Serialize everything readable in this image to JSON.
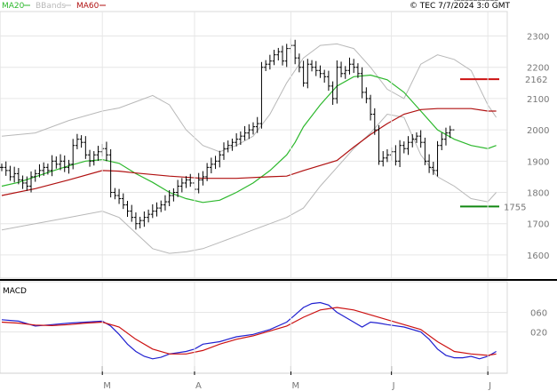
{
  "header": {
    "legend": [
      {
        "label": "MA20",
        "color": "#2db82d"
      },
      {
        "label": "BBands",
        "color": "#b8b8b8"
      },
      {
        "label": "MA60",
        "color": "#b01010"
      }
    ],
    "copyright": "© TEC 7/7/2024 3:0 GMT"
  },
  "colors": {
    "price_bar": "#000000",
    "ma20": "#2db82d",
    "ma60": "#b01010",
    "bbands": "#b8b8b8",
    "grid": "#e6e6e6",
    "resistance": "#cc1111",
    "support": "#118811",
    "macd": "#2020d0",
    "signal": "#cc1111"
  },
  "chart_data": [
    {
      "type": "line",
      "panel": "price",
      "ylim": [
        1540,
        2330
      ],
      "yticks": [
        1600,
        1700,
        1800,
        1900,
        2000,
        2100,
        2200,
        2300
      ],
      "ytick_labels": [
        "1600",
        "1700",
        "1800",
        "1900",
        "2000",
        "2100",
        "2200",
        "2300"
      ],
      "xlim": [
        0,
        120
      ],
      "xticks": [
        24,
        46,
        69,
        93,
        116
      ],
      "xtick_labels": [
        "M",
        "A",
        "M",
        "J",
        "J"
      ],
      "levels": [
        {
          "name": "resistance",
          "value": 2162,
          "label": "2162"
        },
        {
          "name": "support",
          "value": 1755,
          "label": "1755"
        }
      ],
      "series": [
        {
          "name": "MA20",
          "x": [
            0,
            4,
            8,
            12,
            16,
            20,
            24,
            28,
            32,
            36,
            40,
            44,
            48,
            52,
            56,
            60,
            64,
            68,
            70,
            72,
            76,
            80,
            84,
            88,
            92,
            96,
            100,
            104,
            108,
            112,
            116,
            118
          ],
          "values": [
            1820,
            1832,
            1850,
            1868,
            1885,
            1900,
            1905,
            1893,
            1860,
            1832,
            1800,
            1780,
            1768,
            1775,
            1800,
            1830,
            1870,
            1920,
            1960,
            2010,
            2080,
            2140,
            2170,
            2175,
            2160,
            2120,
            2060,
            2000,
            1970,
            1950,
            1940,
            1950
          ]
        },
        {
          "name": "MA60",
          "x": [
            0,
            8,
            16,
            24,
            28,
            32,
            40,
            48,
            56,
            64,
            68,
            72,
            80,
            84,
            88,
            92,
            96,
            100,
            104,
            108,
            112,
            116,
            118
          ],
          "values": [
            1790,
            1812,
            1840,
            1870,
            1868,
            1862,
            1852,
            1845,
            1845,
            1850,
            1852,
            1870,
            1902,
            1945,
            1985,
            2020,
            2050,
            2065,
            2068,
            2068,
            2068,
            2060,
            2060
          ]
        },
        {
          "name": "BBand upper",
          "x": [
            0,
            8,
            16,
            24,
            28,
            32,
            36,
            40,
            44,
            48,
            52,
            56,
            60,
            64,
            68,
            72,
            76,
            80,
            84,
            88,
            92,
            96,
            100,
            104,
            108,
            112,
            116,
            118
          ],
          "values": [
            1980,
            1990,
            2030,
            2060,
            2070,
            2090,
            2110,
            2080,
            2000,
            1950,
            1930,
            1950,
            1980,
            2050,
            2150,
            2230,
            2270,
            2275,
            2260,
            2200,
            2130,
            2100,
            2210,
            2240,
            2225,
            2190,
            2080,
            2040
          ]
        },
        {
          "name": "BBand lower",
          "x": [
            0,
            8,
            16,
            24,
            28,
            32,
            36,
            40,
            44,
            48,
            52,
            56,
            60,
            64,
            68,
            72,
            76,
            80,
            84,
            88,
            92,
            96,
            100,
            104,
            108,
            112,
            116,
            118
          ],
          "values": [
            1680,
            1700,
            1720,
            1740,
            1720,
            1670,
            1620,
            1605,
            1610,
            1620,
            1640,
            1660,
            1680,
            1700,
            1720,
            1750,
            1820,
            1880,
            1940,
            1990,
            2050,
            2040,
            1920,
            1850,
            1820,
            1780,
            1770,
            1800
          ]
        }
      ],
      "ohlc": {
        "x": [
          0,
          1,
          2,
          3,
          4,
          5,
          6,
          7,
          8,
          9,
          10,
          11,
          12,
          13,
          14,
          15,
          16,
          17,
          18,
          19,
          20,
          21,
          22,
          23,
          24,
          25,
          26,
          27,
          28,
          29,
          30,
          31,
          32,
          33,
          34,
          35,
          36,
          37,
          38,
          39,
          40,
          41,
          42,
          43,
          44,
          45,
          46,
          47,
          48,
          49,
          50,
          51,
          52,
          53,
          54,
          55,
          56,
          57,
          58,
          59,
          60,
          61,
          62,
          63,
          64,
          65,
          66,
          67,
          68,
          69,
          70,
          71,
          72,
          73,
          74,
          75,
          76,
          77,
          78,
          79,
          80,
          81,
          82,
          83,
          84,
          85,
          86,
          87,
          88,
          89,
          90,
          91,
          92,
          93,
          94,
          95,
          96,
          97,
          98,
          99,
          100,
          101,
          102,
          103,
          104,
          105,
          106,
          107,
          108,
          109,
          110,
          111,
          112,
          113,
          114,
          115,
          116,
          117,
          118
        ],
        "close": [
          1880,
          1870,
          1850,
          1860,
          1840,
          1830,
          1820,
          1850,
          1860,
          1870,
          1880,
          1870,
          1900,
          1890,
          1900,
          1880,
          1890,
          1950,
          1970,
          1960,
          1920,
          1900,
          1920,
          1930,
          1940,
          1920,
          1800,
          1790,
          1780,
          1760,
          1740,
          1720,
          1700,
          1710,
          1720,
          1730,
          1740,
          1750,
          1760,
          1770,
          1790,
          1800,
          1820,
          1830,
          1840,
          1830,
          1810,
          1840,
          1850,
          1880,
          1890,
          1900,
          1920,
          1940,
          1950,
          1960,
          1970,
          1980,
          1990,
          2000,
          2010,
          2020,
          2200,
          2210,
          2220,
          2240,
          2250,
          2220,
          2260,
          2270,
          2230,
          2200,
          2150,
          2210,
          2200,
          2190,
          2180,
          2170,
          2140,
          2100,
          2200,
          2180,
          2190,
          2210,
          2200,
          2180,
          2120,
          2100,
          2050,
          2000,
          1900,
          1910,
          1920,
          1930,
          1900,
          1950,
          1940,
          1960,
          1970,
          1980,
          1960,
          1900,
          1880,
          1870,
          1950,
          1970,
          1990,
          2000
        ]
      }
    },
    {
      "type": "line",
      "panel": "macd",
      "title": "MACD",
      "ylim": [
        -50,
        110
      ],
      "yticks": [
        20,
        60
      ],
      "ytick_labels": [
        "020",
        "060"
      ],
      "xlim": [
        0,
        120
      ],
      "series": [
        {
          "name": "MACD",
          "x": [
            0,
            4,
            8,
            12,
            16,
            20,
            24,
            26,
            28,
            30,
            32,
            34,
            36,
            38,
            40,
            44,
            46,
            48,
            52,
            56,
            60,
            64,
            68,
            70,
            72,
            74,
            76,
            78,
            80,
            82,
            84,
            86,
            88,
            90,
            92,
            96,
            100,
            102,
            104,
            106,
            108,
            110,
            112,
            114,
            116,
            118
          ],
          "values": [
            45,
            42,
            32,
            35,
            38,
            40,
            42,
            32,
            15,
            -5,
            -20,
            -30,
            -35,
            -32,
            -25,
            -20,
            -15,
            -5,
            0,
            10,
            15,
            25,
            40,
            55,
            70,
            78,
            80,
            75,
            60,
            50,
            40,
            30,
            40,
            38,
            35,
            30,
            20,
            5,
            -15,
            -28,
            -33,
            -33,
            -30,
            -35,
            -30,
            -20
          ]
        },
        {
          "name": "Signal",
          "x": [
            0,
            4,
            8,
            12,
            16,
            20,
            24,
            28,
            32,
            36,
            40,
            44,
            48,
            52,
            56,
            60,
            64,
            68,
            72,
            76,
            80,
            84,
            88,
            92,
            96,
            100,
            104,
            108,
            112,
            116,
            118
          ],
          "values": [
            40,
            38,
            34,
            33,
            35,
            38,
            40,
            30,
            5,
            -15,
            -25,
            -25,
            -18,
            -5,
            5,
            12,
            22,
            32,
            50,
            65,
            70,
            65,
            55,
            45,
            35,
            25,
            0,
            -20,
            -25,
            -28,
            -25
          ]
        }
      ]
    }
  ]
}
